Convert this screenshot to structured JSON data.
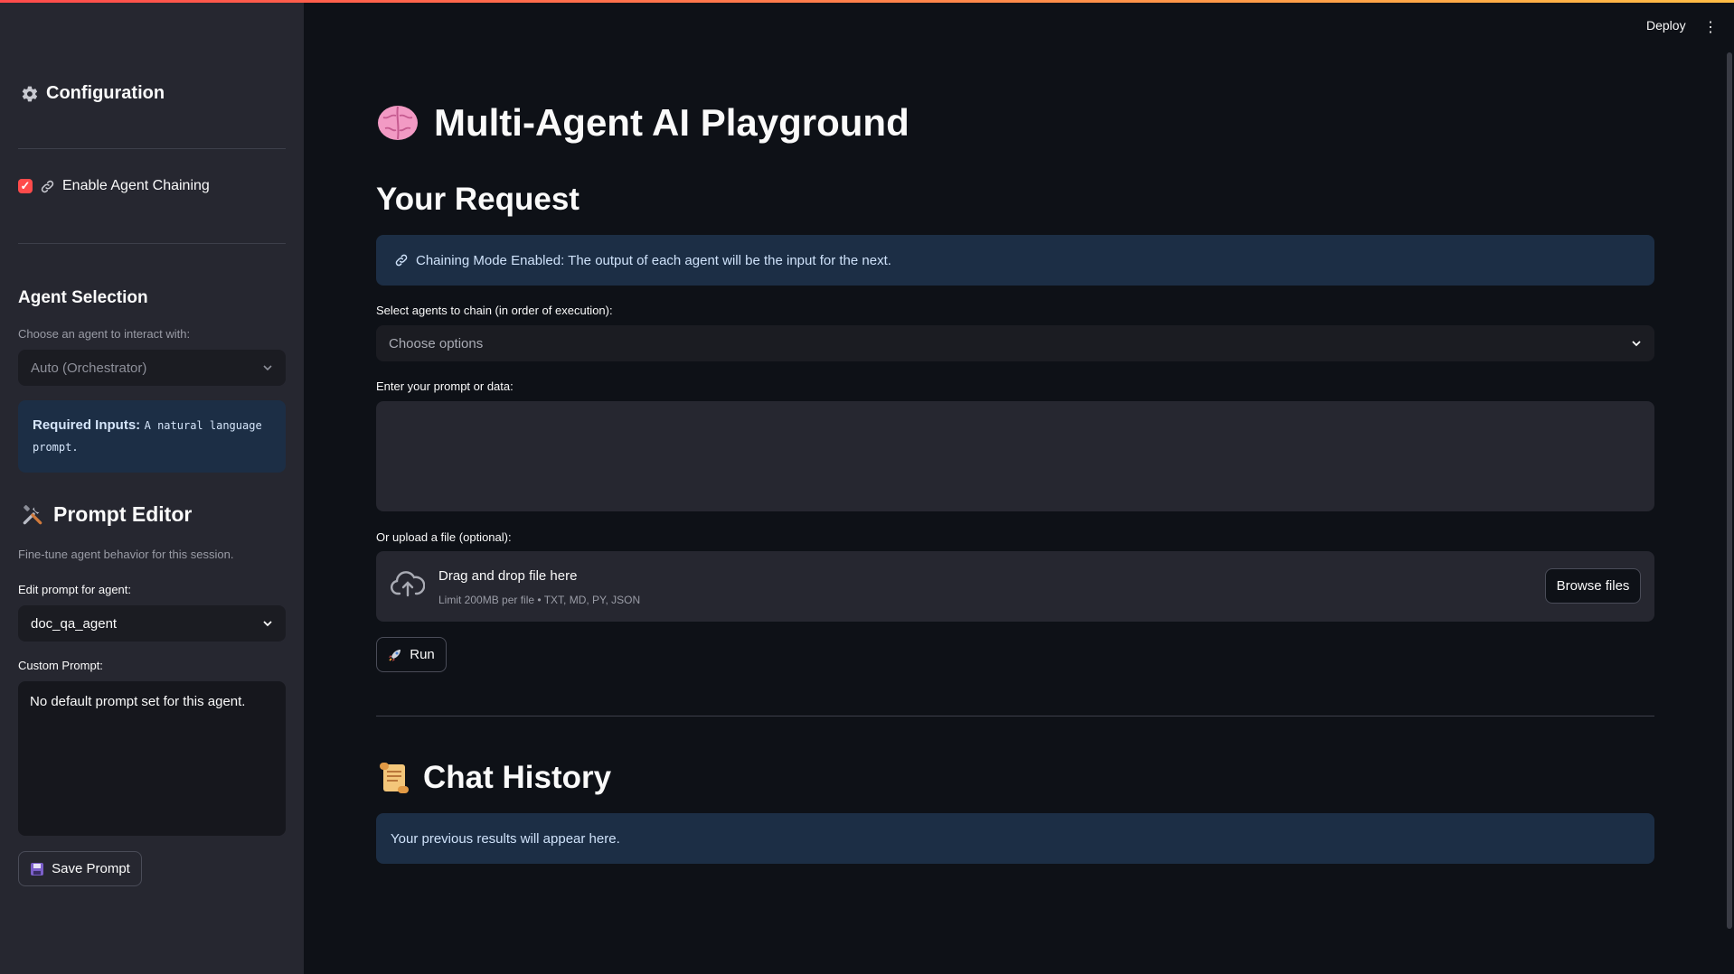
{
  "header": {
    "deploy_label": "Deploy",
    "menu_icon": "⋮"
  },
  "sidebar": {
    "title": "Configuration",
    "chaining": {
      "label": "Enable Agent Chaining",
      "checked": true
    },
    "agent_selection": {
      "title": "Agent Selection",
      "label": "Choose an agent to interact with:",
      "selected": "Auto (Orchestrator)",
      "required_label": "Required Inputs:",
      "required_value": "A natural language prompt."
    },
    "prompt_editor": {
      "title": "Prompt Editor",
      "caption": "Fine-tune agent behavior for this session.",
      "agent_label": "Edit prompt for agent:",
      "agent_selected": "doc_qa_agent",
      "custom_label": "Custom Prompt:",
      "custom_value": "No default prompt set for this agent.",
      "save_label": "Save Prompt"
    }
  },
  "main": {
    "title": "Multi-Agent AI Playground",
    "request_title": "Your Request",
    "chain_info": "Chaining Mode Enabled: The output of each agent will be the input for the next.",
    "agents_label": "Select agents to chain (in order of execution):",
    "agents_placeholder": "Choose options",
    "prompt_label": "Enter your prompt or data:",
    "prompt_value": "",
    "upload_label": "Or upload a file (optional):",
    "upload_title": "Drag and drop file here",
    "upload_limits": "Limit 200MB per file • TXT, MD, PY, JSON",
    "browse_label": "Browse files",
    "run_label": "Run",
    "history_title": "Chat History",
    "history_info": "Your previous results will appear here."
  },
  "colors": {
    "accent": "#ff4b4b",
    "info_bg": "#1c2e45",
    "sidebar_bg": "#262730",
    "main_bg": "#0e1117"
  }
}
